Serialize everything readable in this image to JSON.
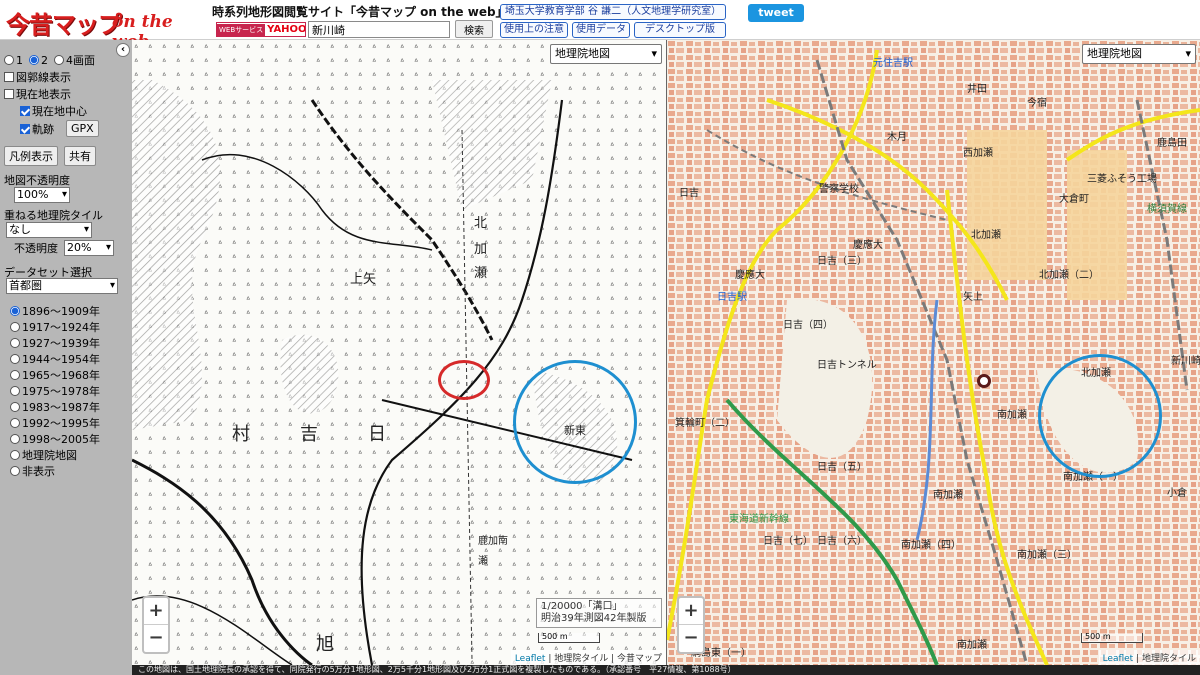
{
  "header": {
    "logo_main": "今昔マップ",
    "logo_sub": "on the web",
    "site_title": "時系列地形図閲覧サイト「今昔マップ on the web」",
    "yahoo_badge_label": "WEBサービス",
    "yahoo_badge_brand": "YAHOO!",
    "search_value": "新川崎",
    "search_button": "検索",
    "author_link": "埼玉大学教育学部 谷 謙二（人文地理学研究室）",
    "notes_link": "使用上の注意",
    "data_link": "使用データ",
    "desktop_link": "デスクトップ版",
    "tweet_label": "tweet"
  },
  "sidebar": {
    "collapse_icon": "‹",
    "screen_options": [
      {
        "label": "1",
        "selected": false
      },
      {
        "label": "2",
        "selected": true
      },
      {
        "label": "4画面",
        "selected": false
      }
    ],
    "checks": [
      {
        "label": "図郭線表示",
        "checked": false,
        "indent": 0
      },
      {
        "label": "現在地表示",
        "checked": false,
        "indent": 0
      },
      {
        "label": "現在地中心",
        "checked": true,
        "indent": 1
      },
      {
        "label": "軌跡",
        "checked": true,
        "indent": 1
      }
    ],
    "gpx_button": "GPX",
    "legend_button": "凡例表示",
    "share_button": "共有",
    "opacity_label": "地図不透明度",
    "opacity_value": "100%",
    "overlay_label": "重ねる地理院タイル",
    "overlay_value": "なし",
    "overlay_opacity_label": "不透明度",
    "overlay_opacity_value": "20%",
    "dataset_label": "データセット選択",
    "dataset_value": "首都圏",
    "periods": [
      {
        "label": "1896～1909年",
        "selected": true
      },
      {
        "label": "1917～1924年",
        "selected": false
      },
      {
        "label": "1927～1939年",
        "selected": false
      },
      {
        "label": "1944～1954年",
        "selected": false
      },
      {
        "label": "1965～1968年",
        "selected": false
      },
      {
        "label": "1975～1978年",
        "selected": false
      },
      {
        "label": "1983～1987年",
        "selected": false
      },
      {
        "label": "1992～1995年",
        "selected": false
      },
      {
        "label": "1998～2005年",
        "selected": false
      },
      {
        "label": "地理院地図",
        "selected": false
      },
      {
        "label": "非表示",
        "selected": false
      }
    ]
  },
  "left_map": {
    "layer": "地理院地図",
    "zoom_in": "+",
    "zoom_out": "−",
    "info_line1": "1/20000「溝口」",
    "info_line2": "明治39年測図42年製版",
    "scale": "500 m",
    "attrib_leaflet": "Leaflet",
    "attrib_rest": "| 地理院タイル | 今昔マップ",
    "labels": [
      "北",
      "加",
      "瀬",
      "村",
      "吉",
      "日",
      "上矢",
      "新東",
      "旭",
      "鹿加南",
      "瀬"
    ]
  },
  "right_map": {
    "layer": "地理院地図",
    "zoom_in": "+",
    "zoom_out": "−",
    "scale": "500 m",
    "attrib_leaflet": "Leaflet",
    "attrib_rest": "| 地理院タイル",
    "labels": [
      "元住吉駅",
      "木月",
      "井田",
      "今宿",
      "西加瀬",
      "三菱ふそう工場",
      "大倉町",
      "警察学校",
      "慶應大",
      "日吉",
      "北加瀬",
      "日吉（三）",
      "慶應大",
      "日吉駅",
      "矢上",
      "北加瀬（二）",
      "日吉（四）",
      "日吉トンネル",
      "北加瀬",
      "新川崎",
      "南加瀬",
      "箕輪町（二）",
      "日吉（五）",
      "南加瀬（一）",
      "東海道新幹線",
      "南加瀬",
      "日吉（七）",
      "日吉（六）",
      "南加瀬（四）",
      "南加瀬（三）",
      "南加瀬",
      "小倉",
      "横須賀線",
      "鹿島田",
      "綱島東（一）"
    ]
  },
  "footer": {
    "text": "この地図は、国土地理院長の承認を得て、同院発行の5万分1地形図、2万5千分1地形図及び2万分1正式図を複製したものである。（承認番号　平27情複、第1088号）"
  },
  "colors": {
    "sidebar": "#b7b7b7",
    "accent": "#1a62d6",
    "circle_blue": "#1e8fd0",
    "circle_red": "#d62a2a",
    "logo_red": "#d81e1e"
  }
}
